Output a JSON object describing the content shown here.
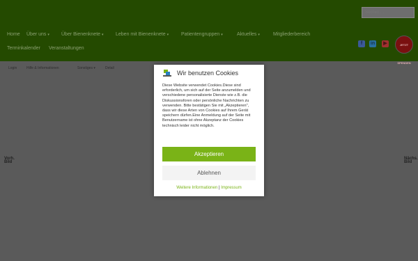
{
  "search": {
    "placeholder": "Suchen ..."
  },
  "nav": {
    "items": [
      {
        "label": "Home",
        "caret": ""
      },
      {
        "label": "Über uns",
        "caret": "▾"
      },
      {
        "label": "Über Bienenknete",
        "caret": "▾"
      },
      {
        "label": "Leben mit Bienenknete",
        "caret": "▾"
      },
      {
        "label": "Patientengruppen",
        "caret": "▾"
      },
      {
        "label": "Aktuelles",
        "caret": "▾"
      },
      {
        "label": "Mitgliederbereich",
        "caret": ""
      },
      {
        "label": "Terminkalender",
        "caret": ""
      },
      {
        "label": "Veranstaltungen",
        "caret": ""
      }
    ]
  },
  "social": {
    "facebook": "f",
    "linkedin": "in",
    "youtube": "▶",
    "donate": "JETZT SPENDEN"
  },
  "breadcrumbs": [
    "Login",
    "Hilfe & Informationen",
    "Sonstiges ▾",
    "Detail"
  ],
  "pager": {
    "prev_top": "Vorh.",
    "prev_bottom": "Bild",
    "next_top": "Nächs.",
    "next_bottom": "Bild"
  },
  "cookie": {
    "title": "Wir benutzen Cookies",
    "body": "Diese Website verwendet Cookies.Diese sind erforderlich, um sich auf der Seite anzumelden und verschiedene personalisierte Dienste wie z.B. die Diskussionsforen oder persönliche Nachrichten zu verwenden. Bitte bestätigen Sie mit „Akzeptieren\", dass wir diese Arten von Cookies auf Ihrem Gerät speichern dürfen.Eine Anmeldung auf der Seite mit Benutzername ist ohne Akzeptanz der Cookies technisch leider nicht möglich.",
    "accept_label": "Akzeptieren",
    "decline_label": "Ablehnen",
    "more_info": "Weitere Informationen",
    "separator": "|",
    "imprint": "Impressum"
  },
  "colors": {
    "header": "#244a00",
    "overlay": "#5a5a5a",
    "accent": "#7ab317",
    "decline_bg": "#f3f3f3"
  }
}
